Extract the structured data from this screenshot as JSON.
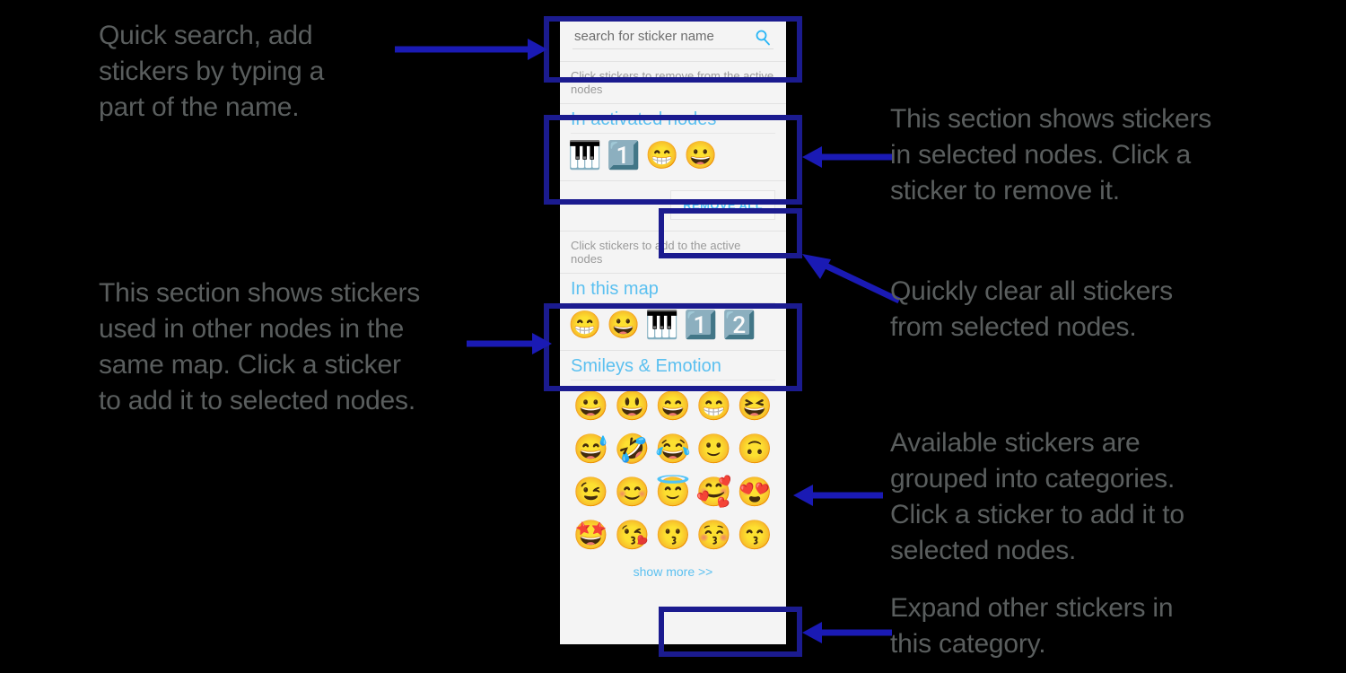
{
  "panel": {
    "search": {
      "placeholder": "search for sticker name",
      "value": "",
      "icon": "search-icon"
    },
    "hint_remove": "Click stickers to remove from the active nodes",
    "hint_add": "Click stickers to add to the active nodes",
    "activated": {
      "title": "In activated nodes",
      "stickers": [
        {
          "name": "musical-keyboard-sticker",
          "glyph": "🎹"
        },
        {
          "name": "keycap-one-sticker",
          "glyph": "1️⃣"
        },
        {
          "name": "beaming-face-with-smiling-eyes-sticker",
          "glyph": "😁"
        },
        {
          "name": "grinning-face-sticker",
          "glyph": "😀"
        }
      ]
    },
    "remove_all_label": "REMOVE ALL",
    "in_this_map": {
      "title": "In this map",
      "stickers": [
        {
          "name": "beaming-face-with-smiling-eyes-sticker",
          "glyph": "😁"
        },
        {
          "name": "grinning-face-sticker",
          "glyph": "😀"
        },
        {
          "name": "musical-keyboard-sticker",
          "glyph": "🎹"
        },
        {
          "name": "keycap-one-sticker",
          "glyph": "1️⃣"
        },
        {
          "name": "keycap-two-sticker",
          "glyph": "2️⃣"
        }
      ]
    },
    "category": {
      "title": "Smileys & Emotion",
      "stickers": [
        {
          "name": "grinning-face-sticker",
          "glyph": "😀"
        },
        {
          "name": "grinning-face-with-big-eyes-sticker",
          "glyph": "😃"
        },
        {
          "name": "grinning-face-with-smiling-eyes-sticker",
          "glyph": "😄"
        },
        {
          "name": "beaming-face-with-smiling-eyes-sticker",
          "glyph": "😁"
        },
        {
          "name": "grinning-squinting-face-sticker",
          "glyph": "😆"
        },
        {
          "name": "grinning-face-with-sweat-sticker",
          "glyph": "😅"
        },
        {
          "name": "rolling-on-the-floor-laughing-sticker",
          "glyph": "🤣"
        },
        {
          "name": "face-with-tears-of-joy-sticker",
          "glyph": "😂"
        },
        {
          "name": "slightly-smiling-face-sticker",
          "glyph": "🙂"
        },
        {
          "name": "upside-down-face-sticker",
          "glyph": "🙃"
        },
        {
          "name": "winking-face-sticker",
          "glyph": "😉"
        },
        {
          "name": "smiling-face-with-smiling-eyes-sticker",
          "glyph": "😊"
        },
        {
          "name": "smiling-face-with-halo-sticker",
          "glyph": "😇"
        },
        {
          "name": "smiling-face-with-hearts-sticker",
          "glyph": "🥰"
        },
        {
          "name": "smiling-face-with-heart-eyes-sticker",
          "glyph": "😍"
        },
        {
          "name": "star-struck-sticker",
          "glyph": "🤩"
        },
        {
          "name": "face-blowing-a-kiss-sticker",
          "glyph": "😘"
        },
        {
          "name": "kissing-face-sticker",
          "glyph": "😗"
        },
        {
          "name": "kissing-face-with-closed-eyes-sticker",
          "glyph": "😚"
        },
        {
          "name": "kissing-face-with-smiling-eyes-sticker",
          "glyph": "😙"
        }
      ],
      "show_more_label": "show more >>"
    }
  },
  "annotations": [
    {
      "name": "annotation-quick-search",
      "text": "Quick search, add\nstickers by typing a\npart of the name."
    },
    {
      "name": "annotation-activated-section",
      "text": "This section shows stickers\nin selected nodes. Click a\nsticker to remove it."
    },
    {
      "name": "annotation-remove-all",
      "text": "Quickly clear all stickers\nfrom selected nodes."
    },
    {
      "name": "annotation-in-this-map",
      "text": "This section shows stickers\nused in other nodes in the\nsame map. Click a sticker\nto add it to selected nodes."
    },
    {
      "name": "annotation-categories",
      "text": "Available stickers are\ngrouped into categories.\nClick a sticker to add it to\nselected nodes."
    },
    {
      "name": "annotation-show-more",
      "text": "Expand other stickers in\nthis category."
    }
  ],
  "colors": {
    "background": "#000000",
    "annotation_text": "#5a5e5e",
    "highlight_box": "#1b1b8f",
    "arrow": "#1a1ab4",
    "panel_bg": "#f4f4f4",
    "section_title": "#5bc0f0",
    "link": "#4fc3f7"
  }
}
